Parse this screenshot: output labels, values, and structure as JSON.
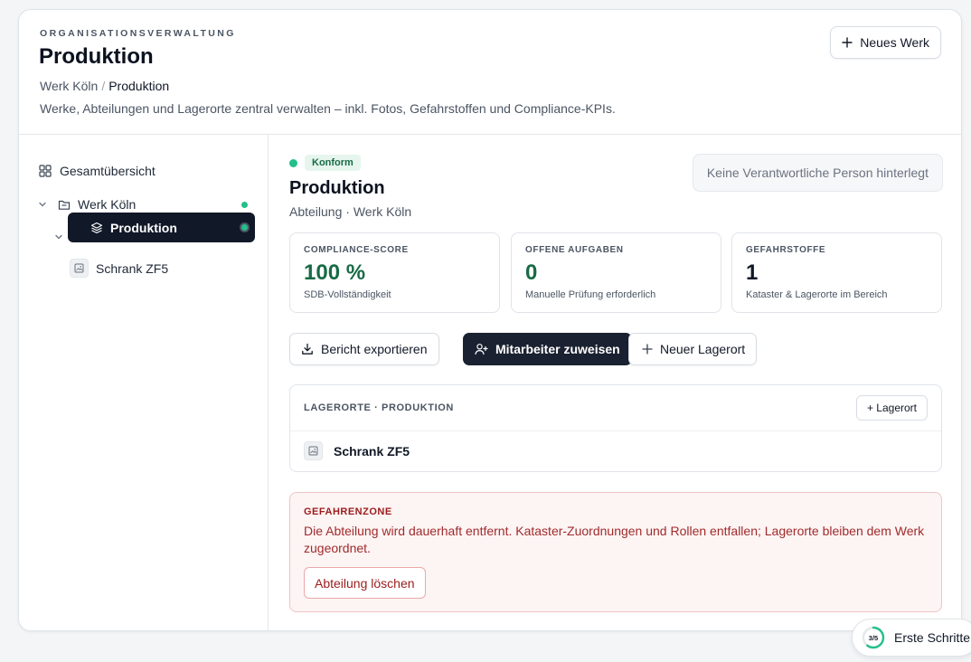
{
  "header": {
    "eyebrow": "ORGANISATIONSVERWALTUNG",
    "title": "Produktion",
    "breadcrumb": {
      "parent": "Werk Köln",
      "separator": "/",
      "current": "Produktion"
    },
    "description": "Werke, Abteilungen und Lagerorte zentral verwalten – inkl. Fotos, Gefahrstoffen und Compliance-KPIs.",
    "new_button_label": "Neues Werk"
  },
  "sidebar": {
    "overview_label": "Gesamtübersicht",
    "tree": {
      "plant": {
        "label": "Werk Köln",
        "status_color": "#22c08a"
      },
      "department": {
        "label": "Produktion",
        "status_color": "#22c08a"
      },
      "storage": {
        "label": "Schrank ZF5"
      }
    }
  },
  "main": {
    "status_badge": "Konform",
    "status_color": "#22c08a",
    "title": "Produktion",
    "subtitle": "Abteilung · Werk Köln",
    "responsible_placeholder": "Keine Verantwortliche Person hinterlegt",
    "kpis": [
      {
        "label": "COMPLIANCE-SCORE",
        "value": "100 %",
        "hint": "SDB-Vollständigkeit"
      },
      {
        "label": "OFFENE AUFGABEN",
        "value": "0",
        "hint": "Manuelle Prüfung erforderlich"
      },
      {
        "label": "GEFAHRSTOFFE",
        "value": "1",
        "hint": "Kataster & Lagerorte im Bereich"
      }
    ],
    "actions": {
      "export_label": "Bericht exportieren",
      "assign_label": "Mitarbeiter zuweisen",
      "new_storage_label": "Neuer Lagerort"
    },
    "storage_panel": {
      "label": "LAGERORTE · PRODUKTION",
      "add_label": "+ Lagerort",
      "items": [
        {
          "label": "Schrank ZF5"
        }
      ]
    },
    "danger_zone": {
      "label": "GEFAHRENZONE",
      "text": "Die Abteilung wird dauerhaft entfernt. Kataster-Zuordnungen und Rollen entfallen; Lagerorte bleiben dem Werk zugeordnet.",
      "delete_label": "Abteilung löschen"
    }
  },
  "onboarding": {
    "progress_label": "3/5",
    "progress": 0.6,
    "label": "Erste Schritte"
  },
  "colors": {
    "accent_dark": "#111827",
    "success": "#22c08a",
    "danger": "#9b1c1c"
  }
}
